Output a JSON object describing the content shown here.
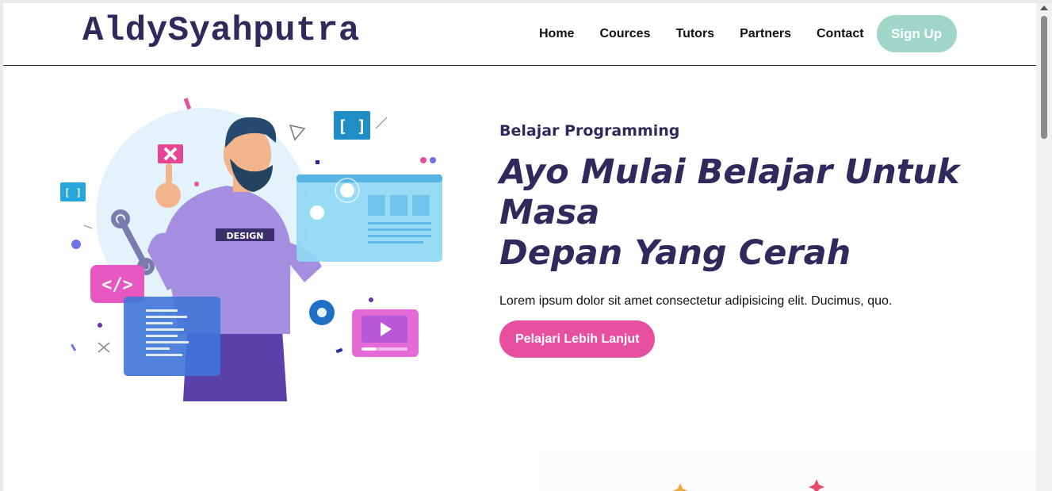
{
  "header": {
    "logo": "AldySyahputra",
    "nav": [
      "Home",
      "Cources",
      "Tutors",
      "Partners",
      "Contact"
    ],
    "signup_label": "Sign Up"
  },
  "hero": {
    "eyebrow": "Belajar Programming",
    "headline_line1": "Ayo Mulai Belajar Untuk Masa",
    "headline_line2": "Depan Yang Cerah",
    "description": "Lorem ipsum dolor sit amet consectetur adipisicing elit. Ducimus, quo.",
    "cta_label": "Pelajari Lebih Lanjut",
    "illustration_badge": "DESIGN",
    "bracket_glyph": "[ ]",
    "code_glyph": "</>"
  },
  "colors": {
    "brand": "#2e2a5c",
    "accent_pink": "#e7509f",
    "signup_green": "#9fd6c7"
  }
}
